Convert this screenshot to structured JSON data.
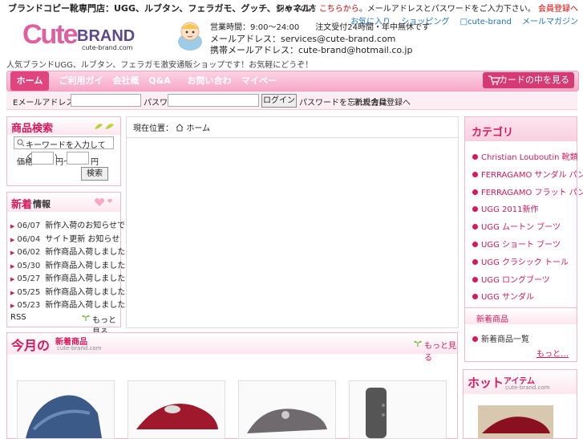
{
  "header": {
    "topline": "ブランドコピー靴専門店：UGG、ルブタン、フェラガモ、グッチ、シャネル！",
    "toplinks_before": "初めての方 ",
    "toplinks_highlight": "こちらから",
    "toplinks_after": "。メールアドレスとパスワードをご入力下さい。 ",
    "toplinks_extra": "会員登録へ",
    "sublinks": [
      "お気に入り",
      "ショッピング",
      "□cute-brand",
      "メールマガジン"
    ],
    "logo_big": "Cute",
    "logo_brand": "BRAND",
    "logo_sub": "cute-brand.com",
    "contact": {
      "hours": "営業時間：9:00〜24:00　　注文受付24時間・年中無休です",
      "email1": "メールアドレス：services@cute-brand.com",
      "email2": "携帯メールアドレス：cute-brand@hotmail.co.jp"
    },
    "tagline": "人気ブランドUGG、ルブタン、フェラガモ激安通販ショップです！お気軽にどうぞ！"
  },
  "nav": {
    "items": [
      "ホーム",
      "ご利用ガイド",
      "会社概要",
      "Q&A",
      "お問い合わせ",
      "マイページ"
    ],
    "cart": "カードの中を見る"
  },
  "login": {
    "email_label": "Eメールアドレス",
    "password_label": "パスワード",
    "login_button": "ログイン",
    "forgot": "パスワードを忘れた方は",
    "register": "新規会員登録へ"
  },
  "search": {
    "title": "商品検索",
    "placeholder": "キーワードを入力してください",
    "price_from_label": "価格",
    "price_to_label": "円〜",
    "price_unit": "円",
    "button": "検索"
  },
  "news": {
    "title_a": "新着",
    "title_b": "情報",
    "items": [
      {
        "date": "06/07",
        "text": "新作入荷のお知らせです"
      },
      {
        "date": "06/04",
        "text": "サイト更新 お知らせ"
      },
      {
        "date": "06/02",
        "text": "新作商品入荷しました"
      },
      {
        "date": "05/30",
        "text": "新作商品入荷しました"
      },
      {
        "date": "05/27",
        "text": "新作商品入荷しました"
      },
      {
        "date": "05/25",
        "text": "新作商品入荷しました"
      },
      {
        "date": "05/23",
        "text": "新作商品入荷しました"
      }
    ],
    "rss": "RSS",
    "more": "もっと見る"
  },
  "main": {
    "breadcrumb_a": "現在位置：",
    "breadcrumb_b": "ホーム"
  },
  "category": {
    "title": "カテゴリ",
    "items": [
      "Christian Louboutin 靴類",
      "FERRAGAMO サンダル パンプス",
      "FERRAGAMO フラット パンプス",
      "UGG 2011新作",
      "UGG ムートン ブーツ",
      "UGG ショート ブーツ",
      "UGG クラシック トール",
      "UGG ロングブーツ",
      "UGG サンダル"
    ],
    "second_title": "新着商品",
    "second_item": "新着商品一覧",
    "more": "もっと…"
  },
  "monthly": {
    "title_a": "今月の",
    "title_b": "新着商品",
    "sub": "cute-brand.com",
    "more": "もっと見る"
  },
  "hot": {
    "title_a": "ホット",
    "title_b": "アイテム",
    "sub": "cute-brand.com"
  }
}
